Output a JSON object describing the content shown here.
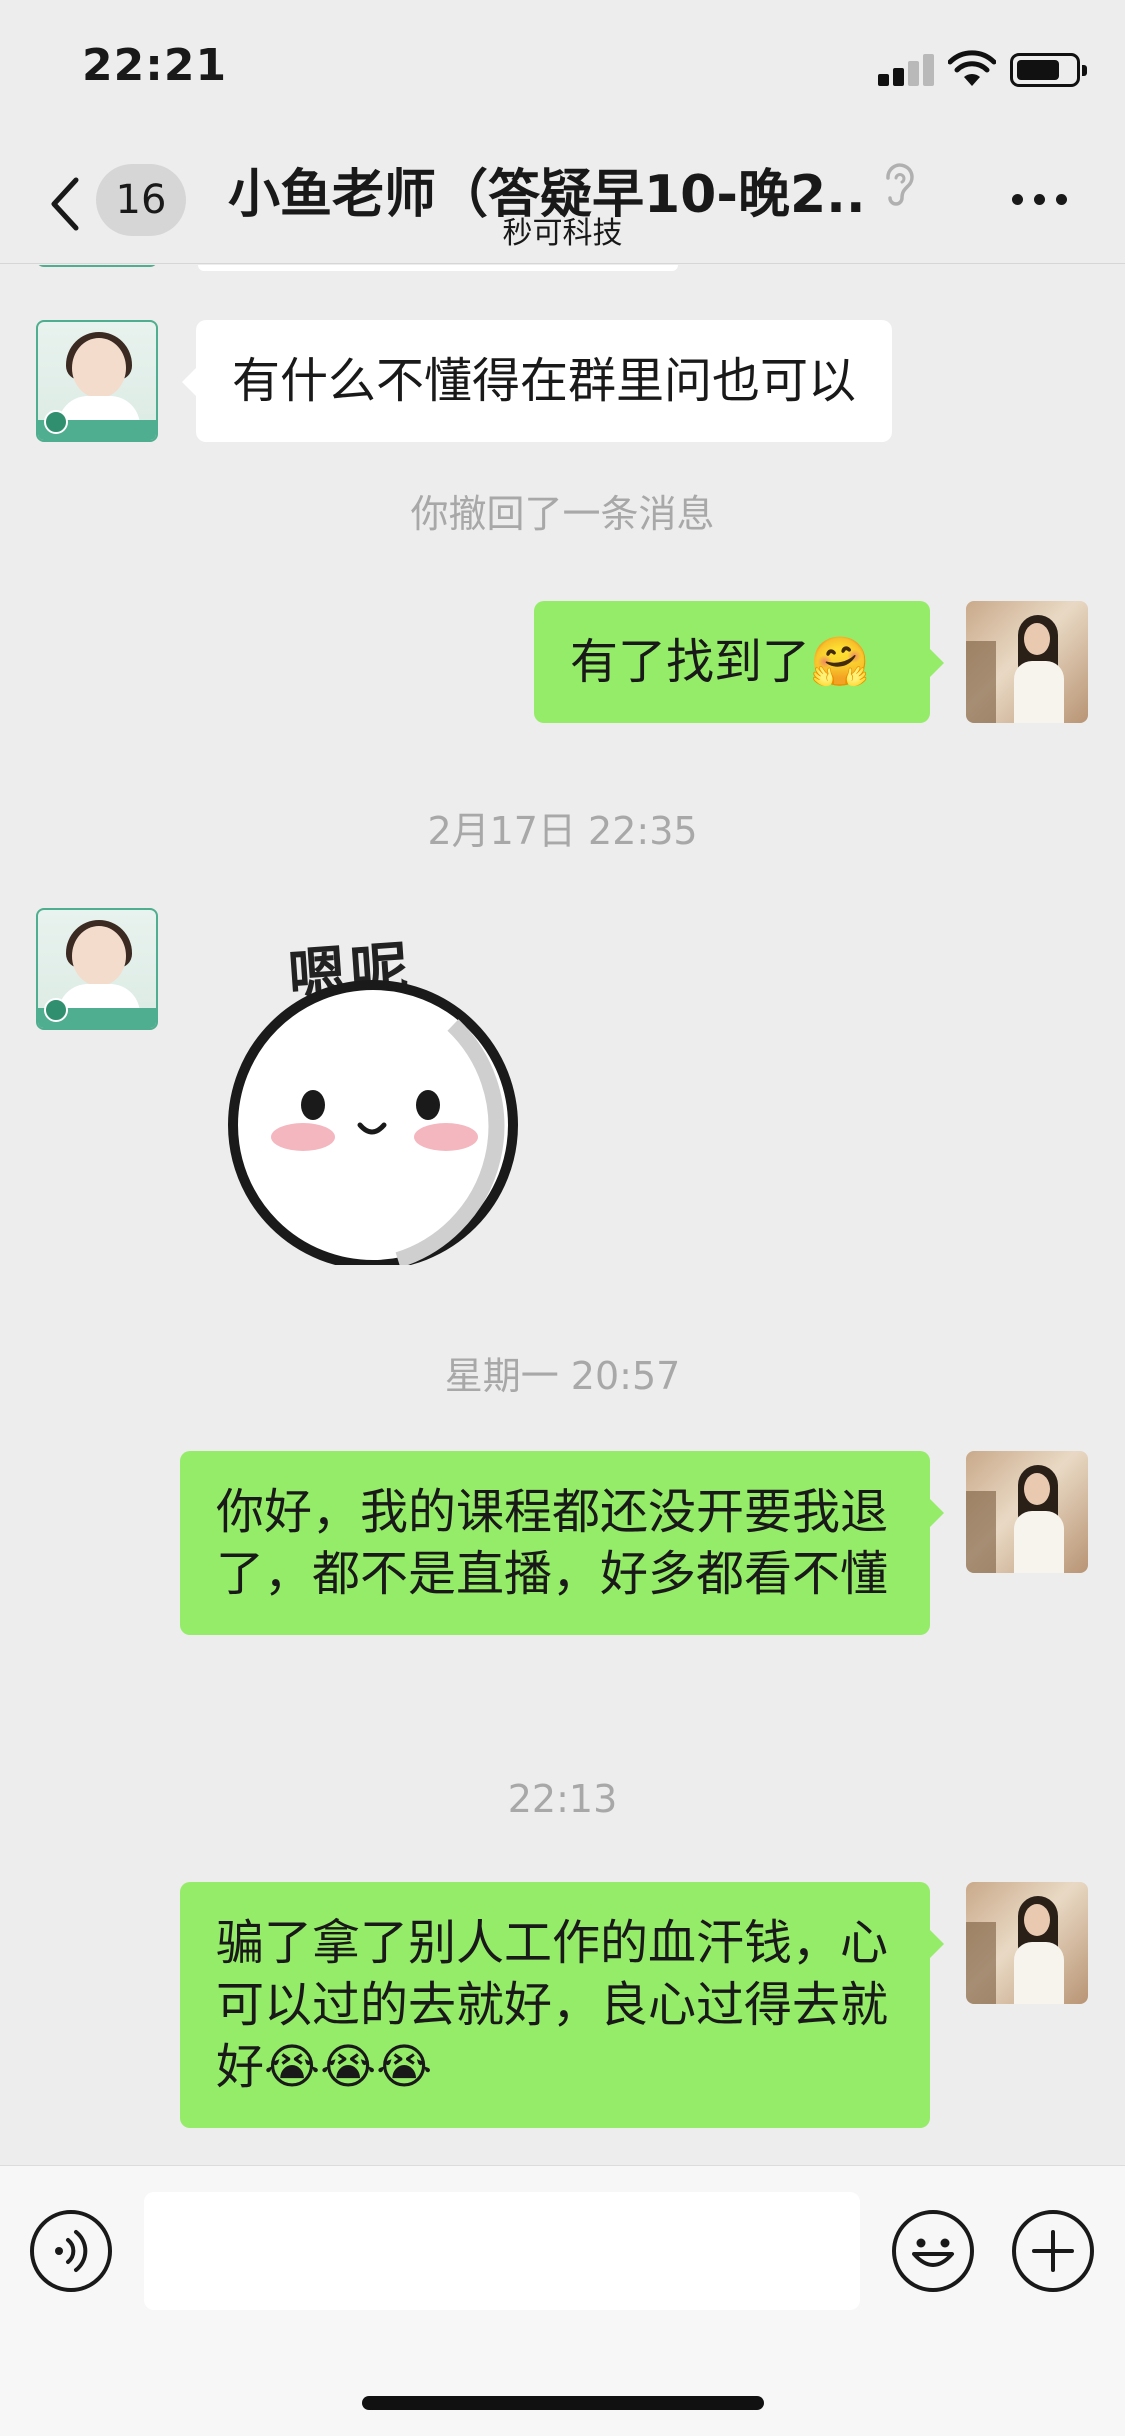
{
  "status_bar": {
    "time": "22:21"
  },
  "nav": {
    "unread_count": "16",
    "title": "小鱼老师（答疑早10-晚2...",
    "subtitle": "秒可科技"
  },
  "messages": {
    "m1": "有什么不懂得在群里问也可以",
    "recall": "你撤回了一条消息",
    "m2": "有了找到了🤗",
    "ts1": "2月17日 22:35",
    "sticker_text": "嗯呢",
    "ts2": "星期一 20:57",
    "m3": "你好，我的课程都还没开要我退了，都不是直播，好多都看不懂",
    "ts3": "22:13",
    "m4": "骗了拿了别人工作的血汗钱，心可以过的去就好，良心过得去就好😭😭😭"
  },
  "icons": {
    "back": "chevron-left-icon",
    "ear": "ear-icon",
    "more": "more-dots-icon",
    "voice": "voice-icon",
    "emoji": "emoji-icon",
    "plus": "plus-icon"
  },
  "colors": {
    "background": "#ededed",
    "sent_bubble": "#95ec69",
    "received_bubble": "#ffffff",
    "system_text": "#a8a8a8"
  }
}
